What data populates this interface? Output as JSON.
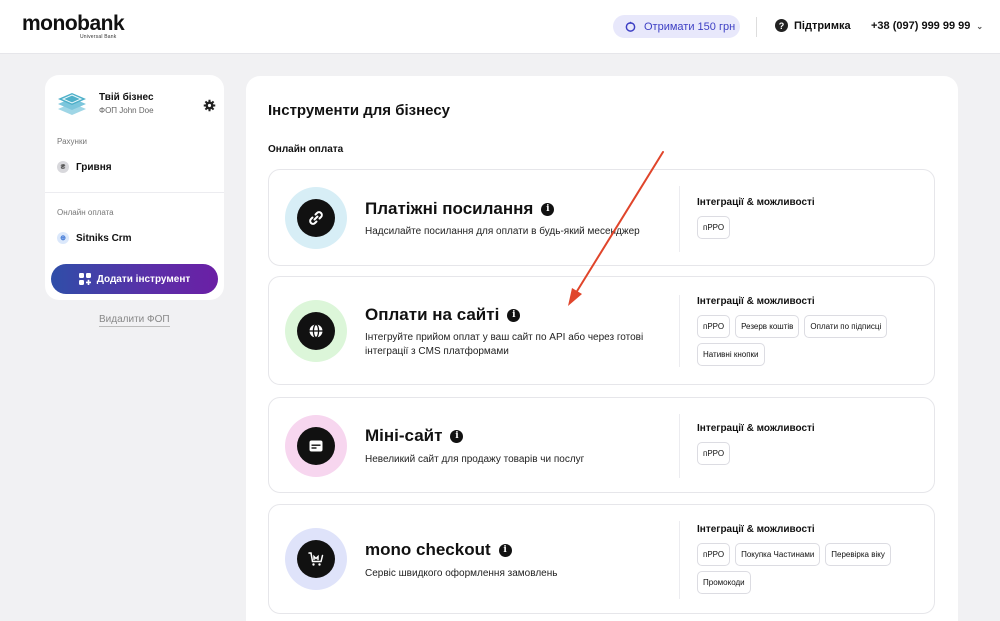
{
  "header": {
    "logo": "monobank",
    "logo_sub": "Universal Bank",
    "bonus_label": "Отримати 150 грн",
    "support_label": "Підтримка",
    "phone": "+38 (097) 999 99 99"
  },
  "sidebar": {
    "business_name": "Твій бізнес",
    "business_owner": "ФОП John Doe",
    "accounts_label": "Рахунки",
    "account_item": "Гривня",
    "online_label": "Онлайн оплата",
    "online_item": "Sitniks Crm",
    "add_tool_label": "Додати інструмент",
    "delete_fop_label": "Видалити ФОП"
  },
  "main": {
    "title": "Інструменти для бізнесу",
    "section_title": "Онлайн оплата",
    "integrations_label": "Інтеграції & можливості",
    "tools": [
      {
        "title": "Платіжні посилання",
        "description": "Надсилайте посилання для оплати в будь-який месенджер",
        "icon": "link-icon",
        "chips": [
          "пРРО"
        ]
      },
      {
        "title": "Оплати на сайті",
        "description": "Інтегруйте прийом оплат у ваш сайт по API або через готові інтеграції з CMS платформами",
        "icon": "globe-icon",
        "chips": [
          "пРРО",
          "Резерв коштів",
          "Оплати по підписці",
          "Нативні кнопки"
        ]
      },
      {
        "title": "Міні-сайт",
        "description": "Невеликий сайт для продажу товарів чи послуг",
        "icon": "browser-window-icon",
        "chips": [
          "пРРО"
        ]
      },
      {
        "title": "mono checkout",
        "description": "Сервіс швидкого оформлення замовлень",
        "icon": "cart-icon",
        "chips": [
          "пРРО",
          "Покупка Частинами",
          "Перевірка віку",
          "Промокоди"
        ]
      }
    ]
  },
  "colors": {
    "accent": "#3d3fc4",
    "button_gradient_start": "#2f4ea8",
    "button_gradient_end": "#6b1fa5",
    "annotation_arrow": "#e0452b"
  }
}
